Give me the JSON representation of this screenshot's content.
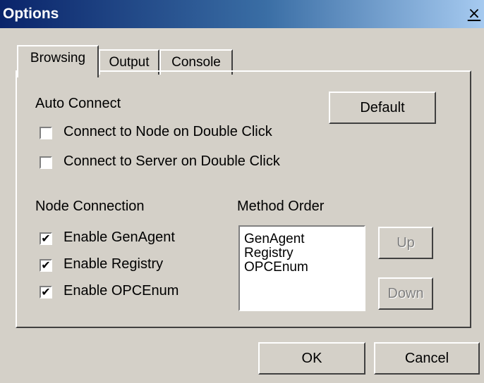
{
  "window": {
    "title": "Options",
    "close_glyph": "×"
  },
  "tabs": [
    {
      "label": "Browsing",
      "active": true
    },
    {
      "label": "Output",
      "active": false
    },
    {
      "label": "Console",
      "active": false
    }
  ],
  "browsing": {
    "auto_connect_label": "Auto Connect",
    "default_button": "Default",
    "connect_node_label": "Connect to Node on Double Click",
    "connect_node_checked": false,
    "connect_server_label": "Connect to Server on Double Click",
    "connect_server_checked": false,
    "node_connection_label": "Node Connection",
    "method_order_label": "Method Order",
    "enable_genagent_label": "Enable GenAgent",
    "enable_genagent_checked": true,
    "enable_registry_label": "Enable Registry",
    "enable_registry_checked": true,
    "enable_opcenum_label": "Enable OPCEnum",
    "enable_opcenum_checked": true,
    "method_order_items": [
      "GenAgent",
      "Registry",
      "OPCEnum"
    ],
    "up_button": "Up",
    "down_button": "Down"
  },
  "footer": {
    "ok_button": "OK",
    "cancel_button": "Cancel"
  },
  "check_glyph": "✔",
  "colors": {
    "titlebar_start": "#0a246a",
    "titlebar_end": "#a6caf0",
    "face": "#d4d0c8"
  }
}
